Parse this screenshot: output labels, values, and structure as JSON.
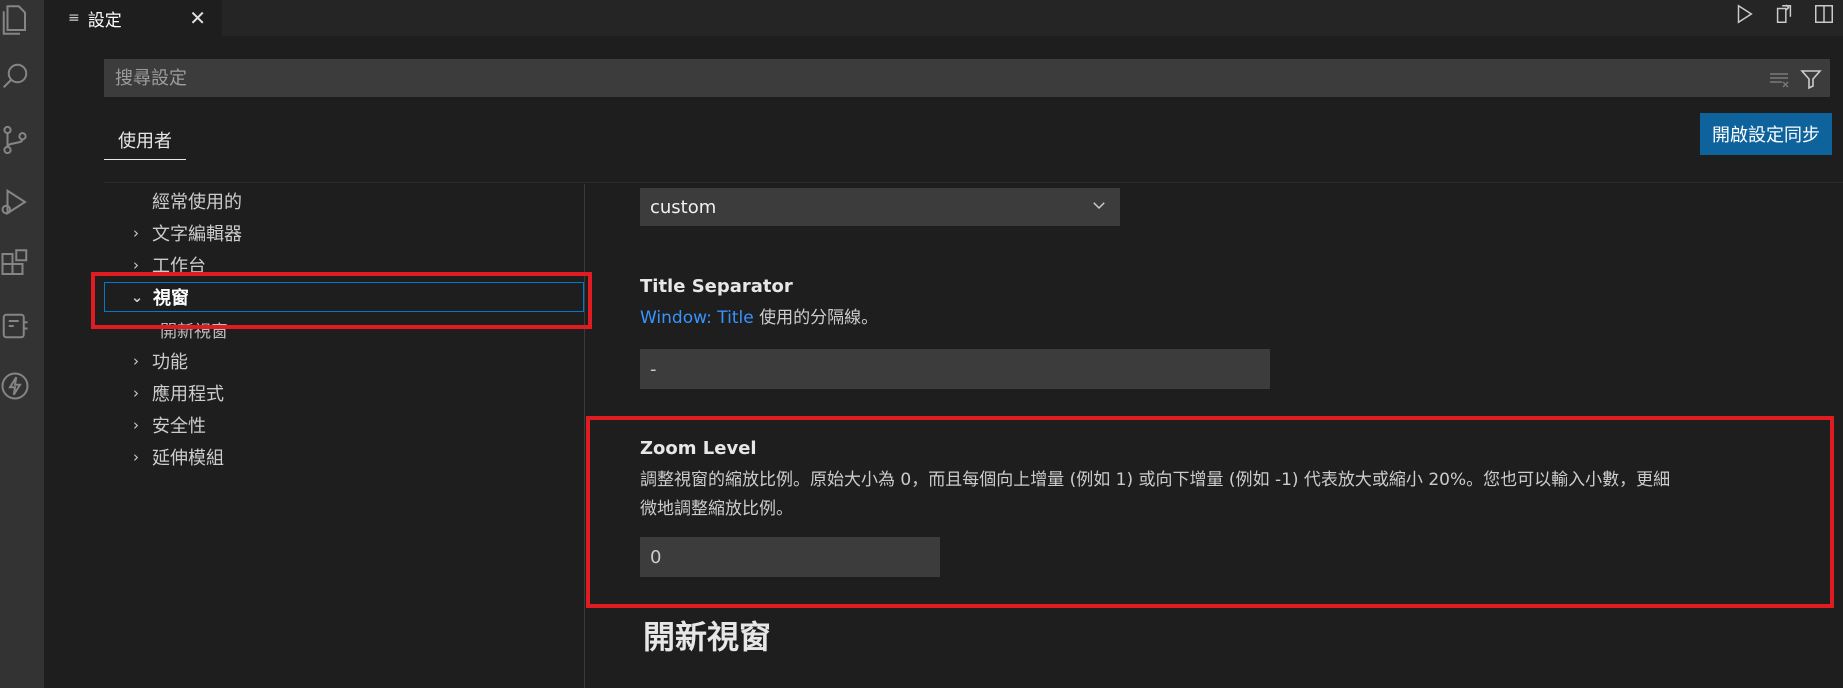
{
  "tab": {
    "icon": "≡",
    "label": "設定",
    "close": "✕"
  },
  "search": {
    "placeholder": "搜尋設定"
  },
  "scope": {
    "user_label": "使用者"
  },
  "sync_button": "開啟設定同步",
  "toc": {
    "items": [
      {
        "label": "經常使用的",
        "chevron": ""
      },
      {
        "label": "文字編輯器",
        "chevron": "›"
      },
      {
        "label": "工作台",
        "chevron": "›"
      },
      {
        "label": "視窗",
        "chevron": "⌄"
      },
      {
        "label": "開新視窗",
        "chevron": ""
      },
      {
        "label": "功能",
        "chevron": "›"
      },
      {
        "label": "應用程式",
        "chevron": "›"
      },
      {
        "label": "安全性",
        "chevron": "›"
      },
      {
        "label": "延伸模組",
        "chevron": "›"
      }
    ]
  },
  "settings": {
    "title_bar_select_value": "custom",
    "title_separator": {
      "title": "Title Separator",
      "desc_link": "Window: Title",
      "desc_rest": " 使用的分隔線。",
      "value": "-"
    },
    "zoom_level": {
      "title": "Zoom Level",
      "desc_line1": "調整視窗的縮放比例。原始大小為 0，而且每個向上增量 (例如 1) 或向下增量 (例如 -1) 代表放大或縮小 20%。您也可以輸入小數，更細",
      "desc_line2": "微地調整縮放比例。",
      "value": "0"
    },
    "section_heading": "開新視窗"
  },
  "colors": {
    "accent": "#007acc",
    "button": "#0e639c",
    "link": "#3794ff",
    "annotation": "#e01c23"
  }
}
